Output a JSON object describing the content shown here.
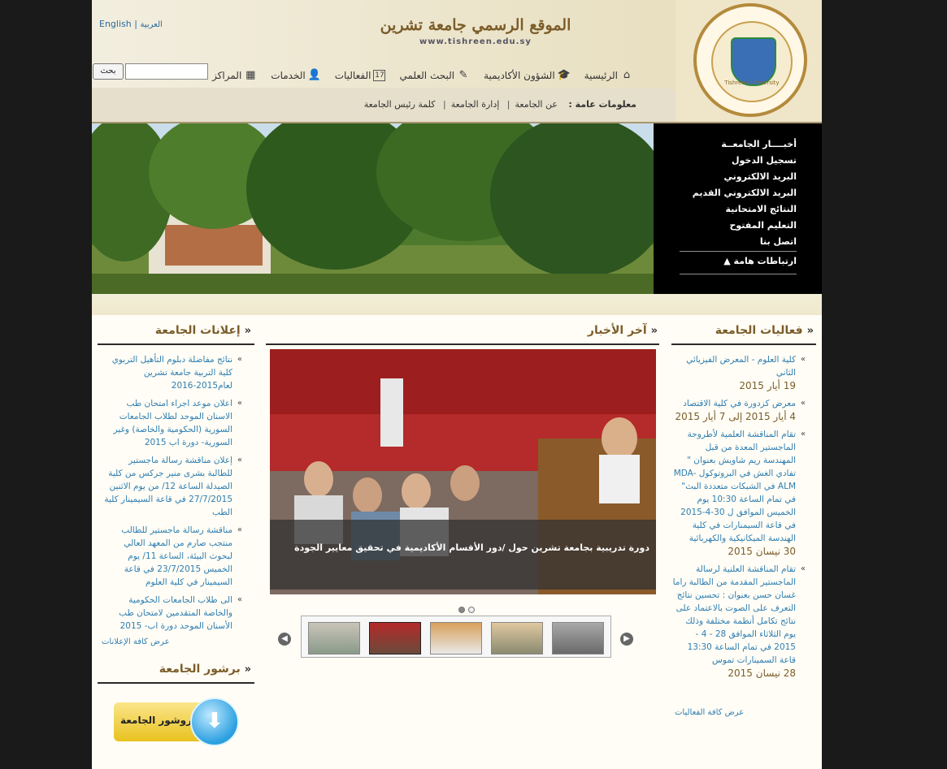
{
  "header": {
    "title": "الموقع الرسمي جامعة تشرين",
    "url": "www.tishreen.edu.sy",
    "lang_en": "English",
    "lang_ar": "العربية",
    "search_button": "بحث",
    "search_value": "",
    "logo_text": "Tishreen University"
  },
  "nav": [
    {
      "label": "الرئيسية",
      "icon": "home-icon"
    },
    {
      "label": "الشؤون الأكاديمية",
      "icon": "graduation-cap-icon"
    },
    {
      "label": "البحث العلمي",
      "icon": "pen-icon"
    },
    {
      "label": "الفعاليات",
      "icon": "calendar-icon"
    },
    {
      "label": "الخدمات",
      "icon": "users-icon"
    },
    {
      "label": "المراكز",
      "icon": "building-icon"
    }
  ],
  "subnav": {
    "heading": "معلومات عامة :",
    "items": [
      "عن الجامعة",
      "إدارة الجامعة",
      "كلمة رئيس الجامعة"
    ]
  },
  "quicklinks": {
    "items": [
      "أخبــــار الجامعــة",
      "تسجيل الدخول",
      "البريد الالكتروني",
      "البريد الالكتروني القديم",
      "النتائج الامتحانية",
      "التعليم المفتوح",
      "اتصل بنا"
    ],
    "important": "ارتباطات هامة ▲"
  },
  "events": {
    "title": "فعاليات الجامعة",
    "items": [
      {
        "text": "كلية العلوم - المعرض الفيزيائي الثاني",
        "date": "19 أيار 2015"
      },
      {
        "text": "معرض كزدورة في كلية الاقتصاد",
        "date": "4 أيار 2015 إلى 7 أيار 2015"
      },
      {
        "text": "تقام المناقشة العلمية لأطروحة الماجستير المعدة من قبل المهندسة ريم شاويش بعنوان \" تفادي الغش في البروتوكول MDA-ALM في الشبكات متعددة البث\" في تمام الساعة 10:30 يوم الخميس الموافق ل 30-4-2015 في قاعة السيمنارات في كلية الهندسة الميكانيكية والكهربائية",
        "date": "30 نيسان 2015"
      },
      {
        "text": "تقام المناقشة العلنية لرسالة الماجستير المقدمة من الطالبة راما غسان حسن بعنوان : تحسين نتائج التعرف على الصوت بالاعتماد على نتائج تكامل أنظمة مختلفة وذلك يوم الثلاثاء الموافق 28 - 4 - 2015 في تمام الساعة 13:30 قاعة السمينارات تموس",
        "date": "28 نيسان 2015"
      }
    ],
    "more": "عرض كافة الفعاليات"
  },
  "news": {
    "title": "آخر الأخبار",
    "caption": "دورة تدريبية بجامعة تشرين حول /دور الأقسام الأكاديمية في تحقيق معايير الجودة"
  },
  "announcements": {
    "title": "إعلانات الجامعة",
    "items": [
      "نتائج مفاضلة دبلوم التأهيل التربوي كلية التربية جامعة تشرين لعام2015-2016",
      "اعلان موعد اجراء امتحان طب الاسنان الموحد لطلاب الجامعات السورية (الحكومية والخاصة) وغير السورية- دورة اب 2015",
      "إعلان مناقشة رسالة ماجستير للطالبة بشرى منير جركس من كلية الصيدلة الساعة 12/ من يوم الاثنين 27/7/2015 في قاعة السيمينار كلية الطب",
      "مناقشة رسالة ماجستير للطالب منتجب صارم من المعهد العالي لبحوث البيئة، الساعة 11/ يوم الخميس 23/7/2015 في قاعة السيمينار في كلية العلوم",
      "الى طلاب الجامعات الحكومية والخاصة المتقدمين لامتحان طب الأسنان الموحد دورة اب- 2015"
    ],
    "more": "عرض كافة الإعلانات"
  },
  "brochure": {
    "title": "برشور الجامعة",
    "button": "بروشور الجامعة"
  },
  "colors": {
    "accent": "#7b5d2a",
    "link": "#2f7eb3"
  }
}
